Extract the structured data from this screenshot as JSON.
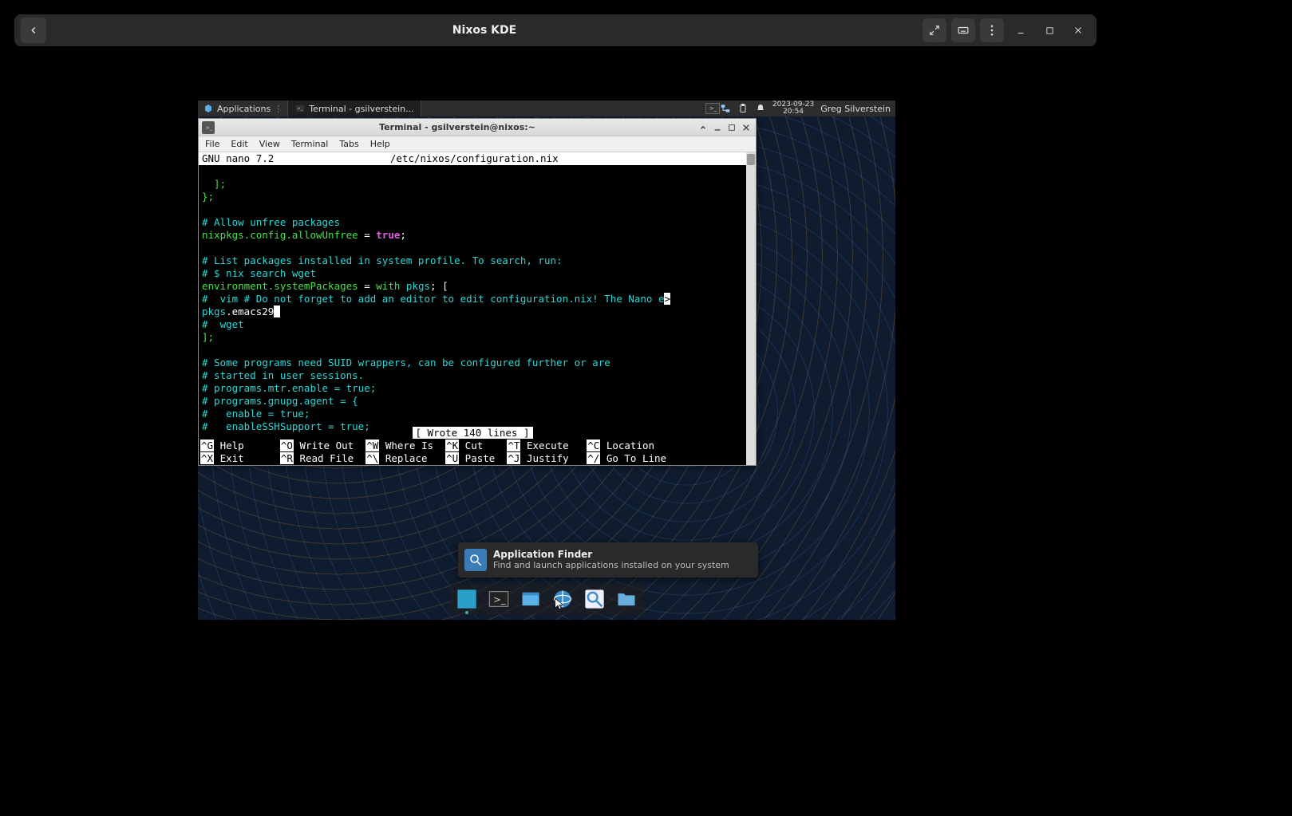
{
  "outer": {
    "title": "Nixos KDE"
  },
  "panel": {
    "applications_label": "Applications",
    "task_label": "Terminal - gsilverstein...",
    "date": "2023-09-23",
    "time": "20:54",
    "username": "Greg Silverstein"
  },
  "terminal": {
    "title": "Terminal - gsilverstein@nixos:~",
    "menu": {
      "file": "File",
      "edit": "Edit",
      "view": "View",
      "terminal": "Terminal",
      "tabs": "Tabs",
      "help": "Help"
    },
    "nano": {
      "app": "GNU nano 7.2",
      "filename": "/etc/nixos/configuration.nix",
      "status": "[ Wrote 140 lines ]",
      "lines": {
        "l1": "  ];",
        "l2": "};",
        "c1": "# Allow unfree packages",
        "assign1_lhs": "nixpkgs.config.allowUnfree ",
        "assign1_eq": "= ",
        "assign1_val": "true",
        "assign1_semi": ";",
        "c2": "# List packages installed in system profile. To search, run:",
        "c3": "# $ nix search wget",
        "assign2_lhs": "environment.systemPackages ",
        "assign2_eq": "= ",
        "assign2_with": "with ",
        "assign2_pkgs": "pkgs",
        "assign2_tail": "; [",
        "c4": "#  vim # Do not forget to add an editor to edit configuration.nix! The Nano e",
        "trunc": ">",
        "pkgs_word": "pkgs",
        "pkgs_dot": ".emacs29",
        "cursor": " ",
        "c5": "#  wget",
        "l3": "];",
        "c6": "# Some programs need SUID wrappers, can be configured further or are",
        "c7": "# started in user sessions.",
        "c8": "# programs.mtr.enable = true;",
        "c9": "# programs.gnupg.agent = {",
        "c10": "#   enable = true;",
        "c11": "#   enableSSHSupport = true;"
      },
      "shortcuts": [
        {
          "key": "^G",
          "label": "Help"
        },
        {
          "key": "^O",
          "label": "Write Out"
        },
        {
          "key": "^W",
          "label": "Where Is"
        },
        {
          "key": "^K",
          "label": "Cut"
        },
        {
          "key": "^T",
          "label": "Execute"
        },
        {
          "key": "^C",
          "label": "Location"
        },
        {
          "key": "^X",
          "label": "Exit"
        },
        {
          "key": "^R",
          "label": "Read File"
        },
        {
          "key": "^\\",
          "label": "Replace"
        },
        {
          "key": "^U",
          "label": "Paste"
        },
        {
          "key": "^J",
          "label": "Justify"
        },
        {
          "key": "^/",
          "label": "Go To Line"
        }
      ]
    }
  },
  "tooltip": {
    "title": "Application Finder",
    "subtitle": "Find and launch applications installed on your system"
  },
  "dock": {
    "items": [
      {
        "name": "show-desktop",
        "color": "#2aa0c8"
      },
      {
        "name": "terminal",
        "color": "#3a3a3a"
      },
      {
        "name": "file-manager",
        "color": "#3a8cc8"
      },
      {
        "name": "web-browser",
        "color": "#2a70b8"
      },
      {
        "name": "app-finder",
        "color": "#3a8cc8"
      },
      {
        "name": "folder",
        "color": "#4a8cc8"
      }
    ]
  }
}
